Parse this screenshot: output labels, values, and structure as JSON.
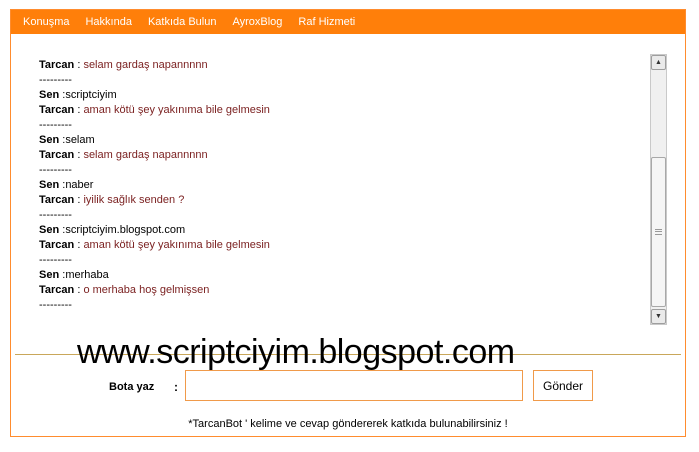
{
  "nav": {
    "items": [
      "Konuşma",
      "Hakkında",
      "Katkıda Bulun",
      "AyroxBlog",
      "Raf Hizmeti"
    ]
  },
  "chat": {
    "messages": [
      {
        "who": "bot",
        "name": "Tarcan",
        "sep": " : ",
        "text": "selam gardaş napannnnn"
      },
      {
        "who": "divider",
        "text": "---------"
      },
      {
        "who": "user",
        "name": "Sen",
        "sep": " :",
        "text": "scriptciyim"
      },
      {
        "who": "bot",
        "name": "Tarcan",
        "sep": " : ",
        "text": "aman kötü şey yakınıma bile gelmesin"
      },
      {
        "who": "divider",
        "text": "---------"
      },
      {
        "who": "user",
        "name": "Sen",
        "sep": " :",
        "text": "selam"
      },
      {
        "who": "bot",
        "name": "Tarcan",
        "sep": " : ",
        "text": "selam gardaş napannnnn"
      },
      {
        "who": "divider",
        "text": "---------"
      },
      {
        "who": "user",
        "name": "Sen",
        "sep": " :",
        "text": "naber"
      },
      {
        "who": "bot",
        "name": "Tarcan",
        "sep": " : ",
        "text": "iyilik sağlık senden ?"
      },
      {
        "who": "divider",
        "text": "---------"
      },
      {
        "who": "user",
        "name": "Sen",
        "sep": " :",
        "text": "scriptciyim.blogspot.com"
      },
      {
        "who": "bot",
        "name": "Tarcan",
        "sep": " : ",
        "text": "aman kötü şey yakınıma bile gelmesin"
      },
      {
        "who": "divider",
        "text": "---------"
      },
      {
        "who": "user",
        "name": "Sen",
        "sep": " :",
        "text": "merhaba"
      },
      {
        "who": "bot",
        "name": "Tarcan",
        "sep": " : ",
        "text": "o merhaba hoş gelmişsen"
      },
      {
        "who": "divider",
        "text": "---------"
      }
    ]
  },
  "watermark": "www.scriptciyim.blogspot.com",
  "form": {
    "label": "Bota yaz",
    "colon": ":",
    "input_value": "",
    "send_label": "Gönder"
  },
  "footer": {
    "note": "*TarcanBot ' kelime ve cevap göndererek katkıda bulunabilirsiniz !"
  },
  "icons": {
    "scroll_up": "triangle-up",
    "scroll_down": "triangle-down",
    "thumb_grip": "grip-lines"
  },
  "colors": {
    "accent": "#ff7f0a",
    "bot_text": "#7a1f1f",
    "divider": "#c9a75a"
  }
}
